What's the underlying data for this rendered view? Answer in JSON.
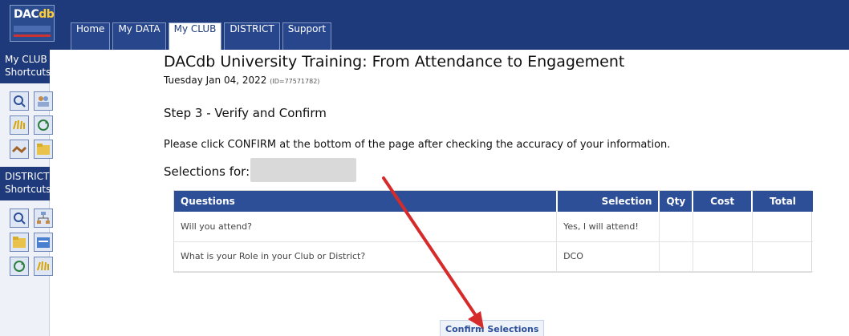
{
  "header": {
    "logo_text_a": "DAC",
    "logo_text_b": "db",
    "tabs": [
      {
        "label": "Home",
        "active": false
      },
      {
        "label": "My DATA",
        "active": false
      },
      {
        "label": "My CLUB",
        "active": true
      },
      {
        "label": "DISTRICT",
        "active": false
      },
      {
        "label": "Support",
        "active": false
      }
    ]
  },
  "sidebar": {
    "club_heading_line1": "My CLUB",
    "club_heading_line2": "Shortcuts",
    "district_heading_line1": "DISTRICT",
    "district_heading_line2": "Shortcuts",
    "club_icons": [
      "magnifier-icon",
      "people-icon",
      "hands-icon",
      "refresh-icon",
      "handshake-icon",
      "folder-icon"
    ],
    "district_icons": [
      "magnifier-icon",
      "org-chart-icon",
      "folder-icon",
      "open-folder-icon",
      "refresh-icon",
      "hands-icon"
    ]
  },
  "main": {
    "title": "DACdb University Training: From Attendance to Engagement",
    "date": "Tuesday Jan 04, 2022",
    "event_id": "(ID=77571782)",
    "step": "Step 3 - Verify and Confirm",
    "instructions": "Please click CONFIRM at the bottom of the page after checking the accuracy of your information.",
    "selections_label": "Selections for:",
    "table": {
      "headers": [
        "Questions",
        "Selection",
        "Qty",
        "Cost",
        "Total"
      ],
      "rows": [
        {
          "question": "Will you attend?",
          "selection": "Yes, I will attend!",
          "qty": "",
          "cost": "",
          "total": ""
        },
        {
          "question": "What is your Role in your Club or District?",
          "selection": "DCO",
          "qty": "",
          "cost": "",
          "total": ""
        }
      ]
    },
    "confirm_label": "Confirm Selections"
  },
  "colors": {
    "header_bg": "#1e3a7a",
    "table_header": "#2c4f97",
    "annotation_arrow": "#d62b2b"
  }
}
